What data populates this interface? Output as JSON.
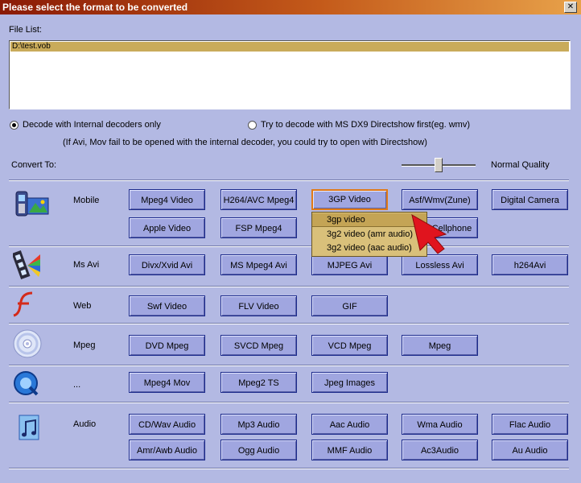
{
  "window": {
    "title": "Please select the format to be converted",
    "close_label": "✕"
  },
  "file_list": {
    "label": "File List:",
    "items": [
      "D:\\test.vob"
    ]
  },
  "decode": {
    "internal_label": "Decode with Internal decoders only",
    "directshow_label": "Try to decode with MS DX9 Directshow first(eg. wmv)",
    "hint": "(If Avi, Mov fail to be opened with the internal decoder, you could try to open with Directshow)"
  },
  "convert_to_label": "Convert To:",
  "quality_label": "Normal Quality",
  "categories": {
    "mobile": {
      "label": "Mobile",
      "buttons": [
        "Mpeg4 Video",
        "H264/AVC Mpeg4",
        "3GP Video",
        "Asf/Wmv(Zune)",
        "Digital Camera",
        "Apple Video",
        "FSP Mpeg4",
        "Cellphone"
      ]
    },
    "msavi": {
      "label": "Ms Avi",
      "buttons": [
        "Divx/Xvid Avi",
        "MS Mpeg4 Avi",
        "MJPEG Avi",
        "Lossless Avi",
        "h264Avi"
      ]
    },
    "web": {
      "label": "Web",
      "buttons": [
        "Swf Video",
        "FLV Video",
        "GIF"
      ]
    },
    "mpeg": {
      "label": "Mpeg",
      "buttons": [
        "DVD Mpeg",
        "SVCD Mpeg",
        "VCD Mpeg",
        "Mpeg"
      ]
    },
    "other": {
      "label": "...",
      "buttons": [
        "Mpeg4 Mov",
        "Mpeg2 TS",
        "Jpeg Images"
      ]
    },
    "audio": {
      "label": "Audio",
      "buttons": [
        "CD/Wav Audio",
        "Mp3 Audio",
        "Aac Audio",
        "Wma Audio",
        "Flac Audio",
        "Amr/Awb Audio",
        "Ogg Audio",
        "MMF Audio",
        "Ac3Audio",
        "Au Audio"
      ]
    }
  },
  "dropdown": {
    "items": [
      "3gp video",
      "3g2 video (amr audio)",
      "3g2 video (aac audio)"
    ]
  },
  "colors": {
    "background": "#b3b9e3",
    "button": "#a0a6e0",
    "selected_border": "#e07a18",
    "dropdown": "#d9c07a",
    "pointer": "#e0141e"
  }
}
